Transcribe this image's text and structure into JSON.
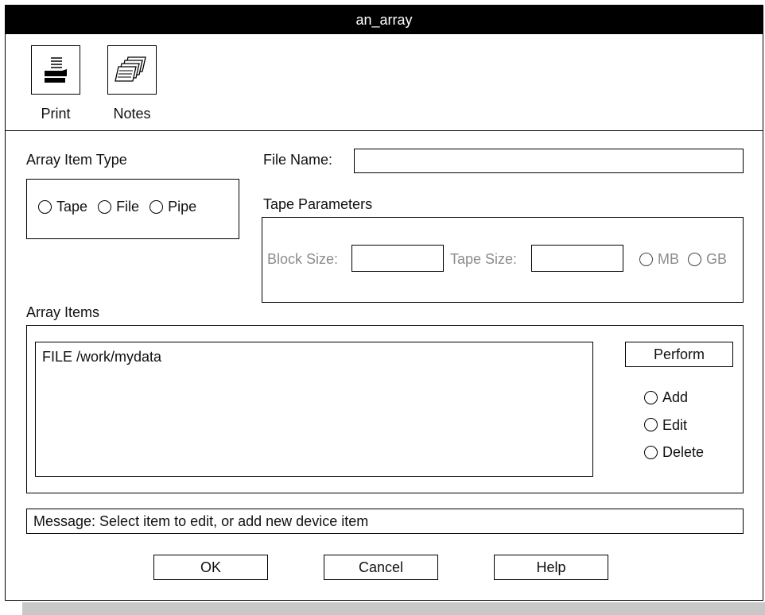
{
  "window": {
    "title": "an_array"
  },
  "toolbar": {
    "print_label": "Print",
    "notes_label": "Notes"
  },
  "array_item_type": {
    "label": "Array Item Type",
    "options": [
      "Tape",
      "File",
      "Pipe"
    ]
  },
  "file_name": {
    "label": "File Name:",
    "value": ""
  },
  "tape_parameters": {
    "label": "Tape Parameters",
    "block_size_label": "Block Size:",
    "block_size_value": "",
    "tape_size_label": "Tape Size:",
    "tape_size_value": "",
    "units": [
      "MB",
      "GB"
    ]
  },
  "array_items": {
    "label": "Array Items",
    "items": [
      "FILE /work/mydata"
    ],
    "perform_label": "Perform",
    "actions": [
      "Add",
      "Edit",
      "Delete"
    ]
  },
  "message": {
    "text": "Message: Select item to edit, or add new device item"
  },
  "buttons": {
    "ok": "OK",
    "cancel": "Cancel",
    "help": "Help"
  }
}
